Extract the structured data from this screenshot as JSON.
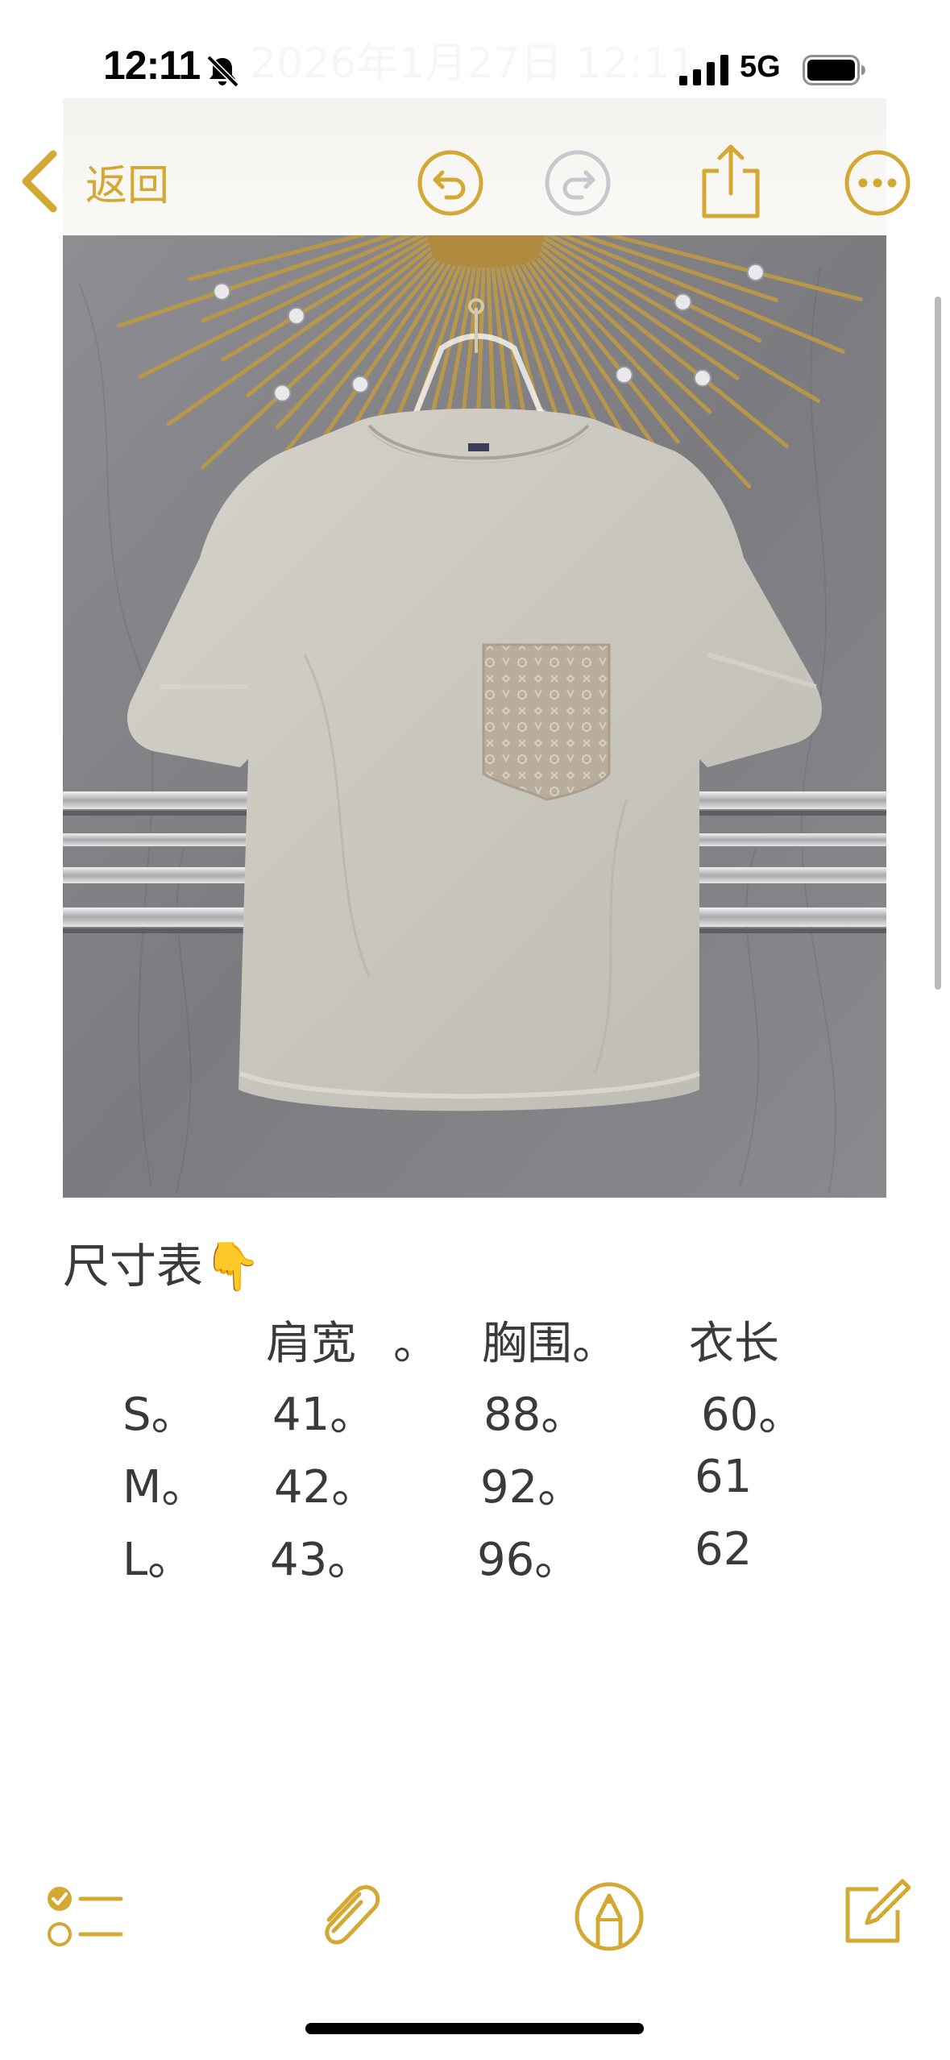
{
  "status_bar": {
    "time": "12:11",
    "network": "5G",
    "background_text": "2026年1月27日 12:11"
  },
  "toolbar": {
    "back_label": "返回",
    "buttons": [
      "undo-icon",
      "redo-icon",
      "share-icon",
      "more-icon"
    ],
    "accent_color": "#d3a833",
    "disabled_color": "#c7c7cc"
  },
  "note": {
    "heading": "尺寸表👇",
    "table": {
      "headers": [
        "肩宽",
        "。",
        "胸围。",
        "衣长"
      ],
      "rows": [
        {
          "size": "S。",
          "shoulder": "41。",
          "chest": "88。",
          "length": "60。"
        },
        {
          "size": "M。",
          "shoulder": "42。",
          "chest": "92。",
          "length": "61"
        },
        {
          "size": "L。",
          "shoulder": "43。",
          "chest": "96。",
          "length": "62"
        }
      ]
    }
  },
  "bottom_toolbar": {
    "buttons": [
      "checklist-icon",
      "attachment-icon",
      "markup-icon",
      "compose-icon"
    ]
  }
}
